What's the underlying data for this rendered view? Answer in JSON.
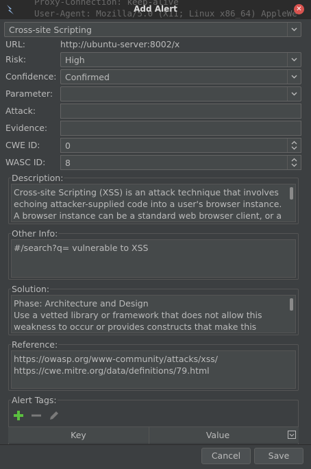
{
  "window": {
    "title": "Add Alert",
    "background_text": [
      "Proxy-Connection: keep-alive",
      "User-Agent: Mozilla/5.0 (X11; Linux x86_64) AppleWe"
    ]
  },
  "form": {
    "alert_name": "Cross-site Scripting",
    "url_label": "URL:",
    "url_value": "http://ubuntu-server:8002/x",
    "risk_label": "Risk:",
    "risk_value": "High",
    "confidence_label": "Confidence:",
    "confidence_value": "Confirmed",
    "parameter_label": "Parameter:",
    "parameter_value": "",
    "attack_label": "Attack:",
    "attack_value": "",
    "evidence_label": "Evidence:",
    "evidence_value": "",
    "cwe_label": "CWE ID:",
    "cwe_value": "0",
    "wasc_label": "WASC ID:",
    "wasc_value": "8"
  },
  "description": {
    "legend": "Description:",
    "text": "Cross-site Scripting (XSS) is an attack technique that involves\nechoing attacker-supplied code into a user's browser instance.\nA browser instance can be a standard web browser client, or a"
  },
  "other_info": {
    "legend": "Other Info:",
    "text": "#/search?q=  vulnerable to XSS"
  },
  "solution": {
    "legend": "Solution:",
    "text": "Phase: Architecture and Design\nUse a vetted library or framework that does not allow this\nweakness to occur or provides constructs that make this"
  },
  "reference": {
    "legend": "Reference:",
    "text": "https://owasp.org/www-community/attacks/xss/\nhttps://cwe.mitre.org/data/definitions/79.html"
  },
  "alert_tags": {
    "legend": "Alert Tags:",
    "columns": [
      "Key",
      "Value"
    ],
    "icons": [
      "add-icon",
      "remove-icon",
      "edit-icon"
    ]
  },
  "buttons": {
    "cancel": "Cancel",
    "save": "Save"
  },
  "colors": {
    "background": "#3c3f41",
    "field": "#45494a",
    "add_icon": "#5bbf3f",
    "close": "#d9534f"
  }
}
